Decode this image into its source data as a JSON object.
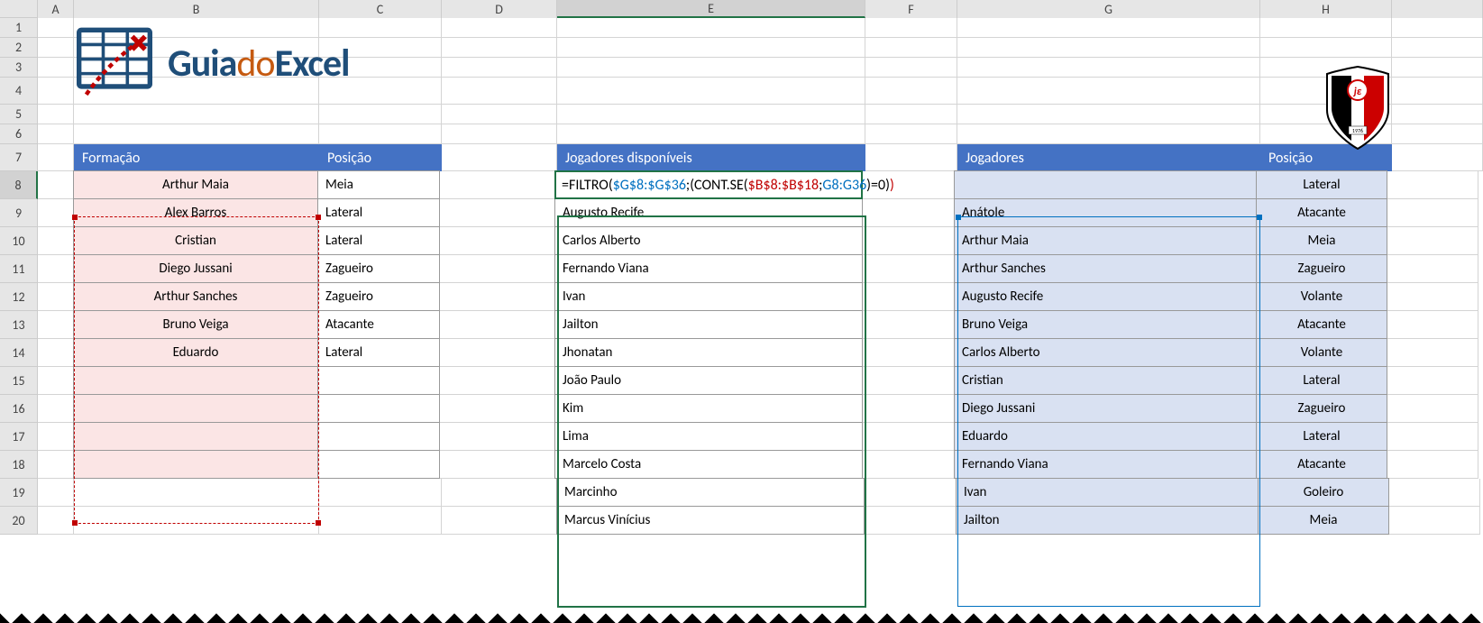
{
  "columns": [
    "A",
    "B",
    "C",
    "D",
    "E",
    "F",
    "G",
    "H"
  ],
  "rows": [
    "1",
    "2",
    "3",
    "4",
    "5",
    "6",
    "7",
    "8",
    "9",
    "10",
    "11",
    "12",
    "13",
    "14",
    "15",
    "16",
    "17",
    "18",
    "19",
    "20"
  ],
  "logo": {
    "part1": "Guia",
    "part2": "do",
    "part3": "Excel"
  },
  "table1": {
    "header1": "Formação",
    "header2": "Posição",
    "rows": [
      {
        "n": "Arthur Maia",
        "p": "Meia"
      },
      {
        "n": "Alex Barros",
        "p": "Lateral"
      },
      {
        "n": "Cristian",
        "p": "Lateral"
      },
      {
        "n": "Diego Jussani",
        "p": "Zagueiro"
      },
      {
        "n": "Arthur Sanches",
        "p": "Zagueiro"
      },
      {
        "n": "Bruno Veiga",
        "p": "Atacante"
      },
      {
        "n": "Eduardo",
        "p": "Lateral"
      },
      {
        "n": "",
        "p": ""
      },
      {
        "n": "",
        "p": ""
      },
      {
        "n": "",
        "p": ""
      },
      {
        "n": "",
        "p": ""
      }
    ]
  },
  "table2": {
    "header": "Jogadores disponíveis",
    "rows": [
      "",
      "Augusto Recife",
      "Carlos Alberto",
      "Fernando Viana",
      "Ivan",
      "Jailton",
      "Jhonatan",
      "João Paulo",
      "Kim",
      "Lima",
      "Marcelo Costa",
      "Marcinho",
      "Marcus Vinícius"
    ]
  },
  "table3": {
    "header1": "Jogadores",
    "header2": "Posição",
    "rows": [
      {
        "n": "",
        "p": "Lateral"
      },
      {
        "n": "Anátole",
        "p": "Atacante"
      },
      {
        "n": "Arthur Maia",
        "p": "Meia"
      },
      {
        "n": "Arthur Sanches",
        "p": "Zagueiro"
      },
      {
        "n": "Augusto Recife",
        "p": "Volante"
      },
      {
        "n": "Bruno Veiga",
        "p": "Atacante"
      },
      {
        "n": "Carlos Alberto",
        "p": "Volante"
      },
      {
        "n": "Cristian",
        "p": "Lateral"
      },
      {
        "n": "Diego Jussani",
        "p": "Zagueiro"
      },
      {
        "n": "Eduardo",
        "p": "Lateral"
      },
      {
        "n": "Fernando Viana",
        "p": "Atacante"
      },
      {
        "n": "Ivan",
        "p": "Goleiro"
      },
      {
        "n": "Jailton",
        "p": "Meia"
      }
    ]
  },
  "formula": {
    "p1": "=FILTRO(",
    "p2": "$G$8:$G$36",
    "p3": ";(CONT.SE(",
    "p4": "$B$8:$B$18",
    "p5": ";",
    "p6": "G8:G36",
    "p7": ")=0)",
    "p8": ")"
  }
}
